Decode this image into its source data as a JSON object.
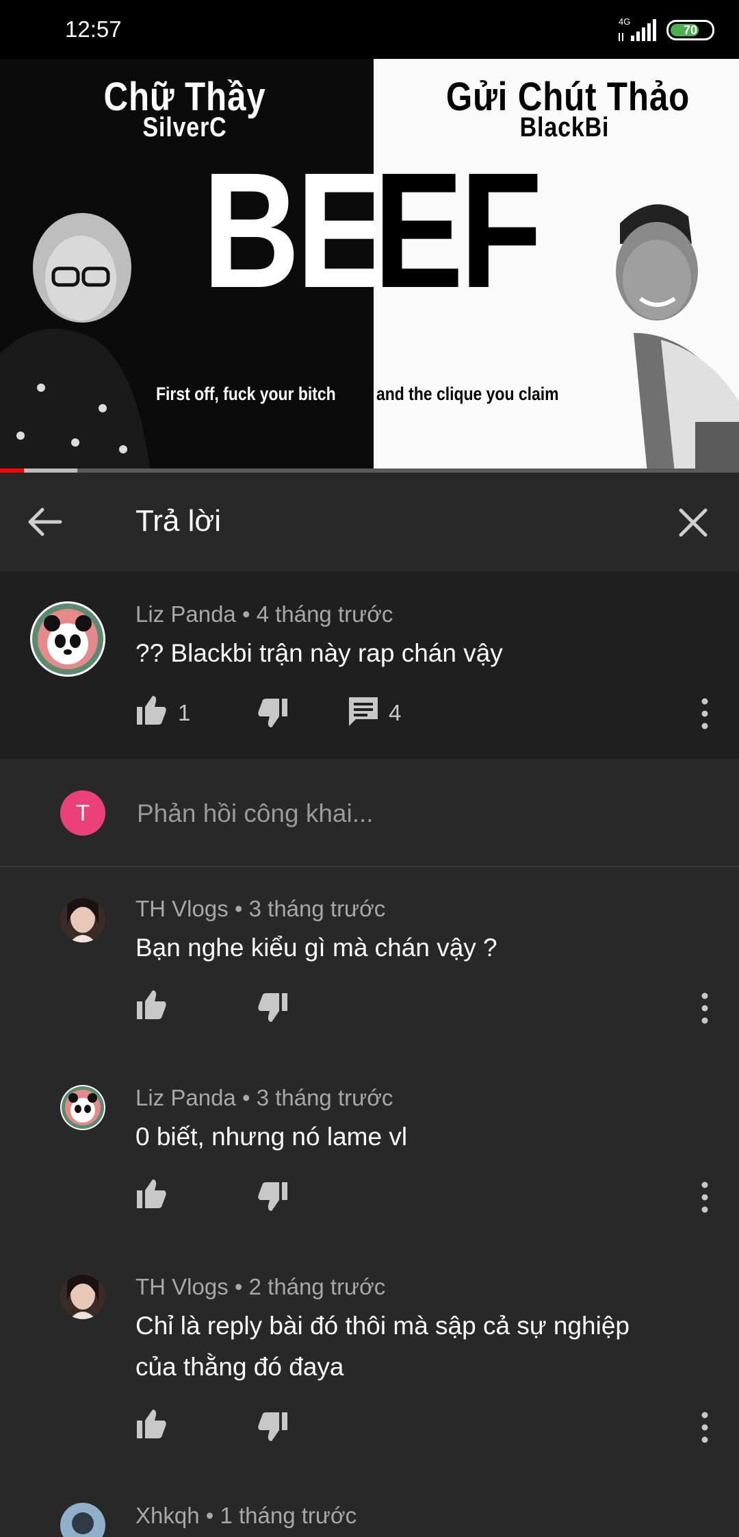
{
  "status_bar": {
    "time": "12:57",
    "network": "4G",
    "battery": "70",
    "battery_level_pct": 70
  },
  "video": {
    "left_title": "Chữ Thầy",
    "left_subtitle": "SilverC",
    "right_title": "Gửi Chút Thảo",
    "right_subtitle": "BlackBi",
    "big_left": "BE",
    "big_right": "EF",
    "lyric_left": "First off, fuck your bitch",
    "lyric_right": "and the clique you claim",
    "played_pct": 3.2,
    "buffered_pct": 10.5
  },
  "header": {
    "title": "Trả lời"
  },
  "main_comment": {
    "author": "Liz Panda",
    "time": "4 tháng trước",
    "text": "?? Blackbi trận này rap chán vậy",
    "likes": "1",
    "replies": "4"
  },
  "reply_box": {
    "avatar_letter": "T",
    "placeholder": "Phản hồi công khai..."
  },
  "replies": [
    {
      "author": "TH Vlogs",
      "time": "3 tháng trước",
      "text": "Bạn nghe kiểu gì mà chán vậy ?"
    },
    {
      "author": "Liz Panda",
      "time": "3 tháng trước",
      "text": "0 biết, nhưng nó lame vl"
    },
    {
      "author": "TH Vlogs",
      "time": "2 tháng trước",
      "text_line1": "Chỉ là reply bài đó thôi mà sập cả sự nghiệp",
      "text_line2": "của thằng đó đaya"
    },
    {
      "author": "Xhkqh",
      "time": "1 tháng trước"
    }
  ],
  "separator": "•",
  "colors": {
    "background": "#282828",
    "highlight": "#1f1f1f",
    "accent_red": "#ff0000",
    "avatar_pink": "#ec407a"
  }
}
